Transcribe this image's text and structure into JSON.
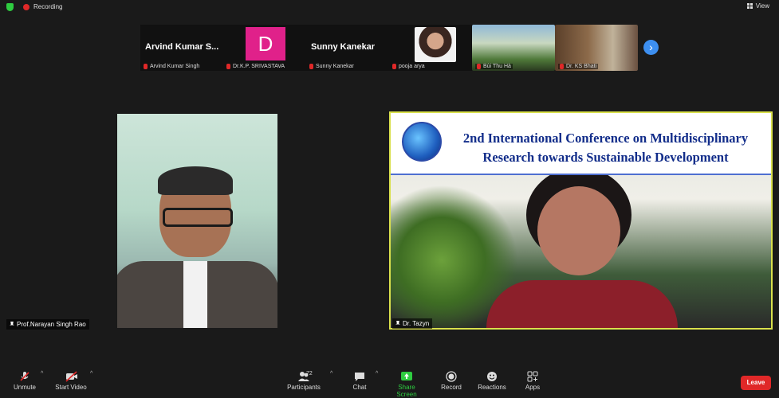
{
  "topbar": {
    "recording": "Recording",
    "view": "View"
  },
  "strip": {
    "tiles": [
      {
        "bigname": "Arvind Kumar S...",
        "label": "Arvind Kumar Singh"
      },
      {
        "avatar_letter": "D",
        "label": "Dr.K.P. SRIVASTAVA"
      },
      {
        "bigname": "Sunny Kanekar",
        "label": "Sunny Kanekar"
      },
      {
        "label": "pooja arya"
      },
      {
        "label": "Bùi Thu Hà"
      },
      {
        "label": "Dr. KS Bhati"
      }
    ]
  },
  "video_left": {
    "name": "Prof.Narayan Singh Rao"
  },
  "video_right": {
    "name": "Dr. Tazyn",
    "banner_line1": "2nd International Conference on Multidisciplinary",
    "banner_line2": "Research towards Sustainable Development"
  },
  "toolbar": {
    "unmute": "Unmute",
    "start_video": "Start Video",
    "participants": "Participants",
    "participants_count": "72",
    "chat": "Chat",
    "share_screen": "Share Screen",
    "record": "Record",
    "reactions": "Reactions",
    "apps": "Apps",
    "leave": "Leave"
  },
  "colors": {
    "accent_green": "#2ecc40",
    "leave_red": "#e02828",
    "active_border": "#d9e04c",
    "share_green": "#2ecc40",
    "nav_blue": "#3d8ff0"
  }
}
